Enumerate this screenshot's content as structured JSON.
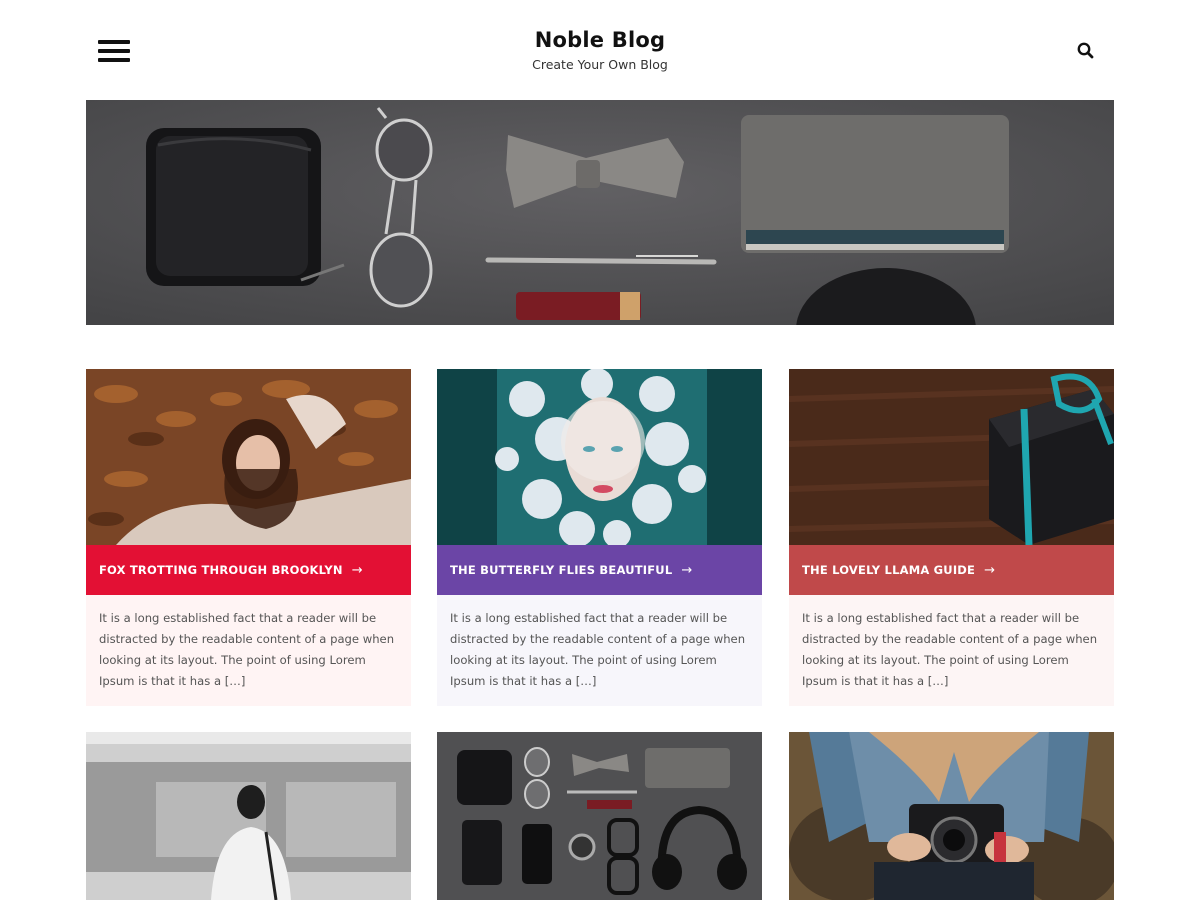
{
  "header": {
    "menu_icon": "hamburger-menu-icon",
    "site_title": "Noble Blog",
    "site_description": "Create Your Own Blog",
    "search_icon": "search-icon"
  },
  "hero": {
    "image": "flat-lay of wallet, aviator sunglasses, bow tie, pen, notebook and lip balm on grey background"
  },
  "posts": [
    {
      "title": "FOX TROTTING THROUGH BROOKLYN",
      "arrow": "→",
      "excerpt": "It is a long established fact that a reader will be distracted by the readable content of a page when looking at its layout. The point of using Lorem Ipsum is that it has a […]",
      "accent": "#e31034",
      "excerpt_bg": "#fff4f4",
      "image": "woman lying in autumn leaves"
    },
    {
      "title": "THE BUTTERFLY FLIES BEAUTIFUL",
      "arrow": "→",
      "excerpt": "It is a long established fact that a reader will be distracted by the readable content of a page when looking at its layout. The point of using Lorem Ipsum is that it has a […]",
      "accent": "#6b45a6",
      "excerpt_bg": "#f7f6fb",
      "image": "woman surrounded by white flowers"
    },
    {
      "title": "THE LOVELY LLAMA GUIDE",
      "arrow": "→",
      "excerpt": "It is a long established fact that a reader will be distracted by the readable content of a page when looking at its layout. The point of using Lorem Ipsum is that it has a […]",
      "accent": "#c0494a",
      "excerpt_bg": "#fdf5f5",
      "image": "black gift box with teal ribbon on wooden table"
    },
    {
      "image": "woman standing by moving train"
    },
    {
      "image": "flat-lay of accessories with headphones"
    },
    {
      "image": "woman holding a camera"
    }
  ]
}
